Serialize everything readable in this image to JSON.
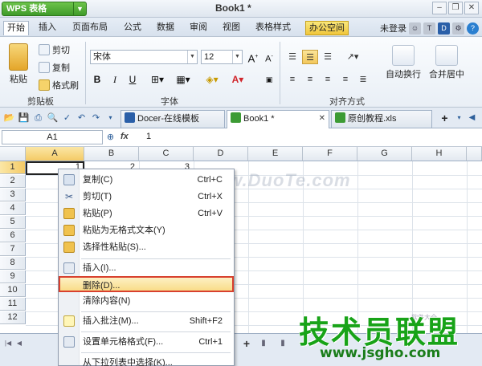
{
  "title_bar": {
    "app_name": "WPS 表格",
    "doc_title": "Book1 *"
  },
  "menu": {
    "tabs": [
      "开始",
      "插入",
      "页面布局",
      "公式",
      "数据",
      "审阅",
      "视图",
      "表格样式",
      "办公空间"
    ],
    "login": "未登录"
  },
  "ribbon": {
    "paste": "粘贴",
    "cut": "剪切",
    "copy": "复制",
    "format_painter": "格式刷",
    "clipboard_group": "剪贴板",
    "font_name": "宋体",
    "font_size": "12",
    "font_group": "字体",
    "bold": "B",
    "italic": "I",
    "underline": "U",
    "align_group": "对齐方式",
    "wrap_text": "自动换行",
    "merge_center": "合并居中"
  },
  "doc_tabs": [
    {
      "label": "Docer-在线模板",
      "icon": "docer-icon"
    },
    {
      "label": "Book1 *",
      "icon": "sheet-icon"
    },
    {
      "label": "原创教程.xls",
      "icon": "sheet-icon"
    }
  ],
  "formula_bar": {
    "cell_ref": "A1",
    "fx": "fx",
    "value": "1"
  },
  "grid": {
    "columns": [
      "A",
      "B",
      "C",
      "D",
      "E",
      "F",
      "G",
      "H"
    ],
    "rows": [
      "1",
      "2",
      "3",
      "4",
      "5",
      "6",
      "7",
      "8",
      "9",
      "10",
      "11",
      "12"
    ],
    "row1_values": [
      "1",
      "2",
      "3"
    ]
  },
  "context_menu": {
    "items": [
      {
        "label": "复制(C)",
        "shortcut": "Ctrl+C",
        "icon": "copy-icon"
      },
      {
        "label": "剪切(T)",
        "shortcut": "Ctrl+X",
        "icon": "cut-icon"
      },
      {
        "label": "粘贴(P)",
        "shortcut": "Ctrl+V",
        "icon": "paste-icon"
      },
      {
        "label": "粘贴为无格式文本(Y)",
        "shortcut": "",
        "icon": "paste-text-icon"
      },
      {
        "label": "选择性粘贴(S)...",
        "shortcut": "",
        "icon": "paste-special-icon"
      },
      {
        "label": "插入(I)...",
        "shortcut": "",
        "icon": "insert-icon"
      },
      {
        "label": "删除(D)...",
        "shortcut": "",
        "icon": ""
      },
      {
        "label": "清除内容(N)",
        "shortcut": "",
        "icon": ""
      },
      {
        "label": "插入批注(M)...",
        "shortcut": "Shift+F2",
        "icon": "comment-icon"
      },
      {
        "label": "设置单元格格式(F)...",
        "shortcut": "Ctrl+1",
        "icon": "format-cells-icon"
      },
      {
        "label": "从下拉列表中选择(K)...",
        "shortcut": "",
        "icon": ""
      }
    ]
  },
  "watermarks": {
    "site1": "www.DuoTe.com",
    "brand": "技术员联盟",
    "url": "www.jsgho.com"
  },
  "colors": {
    "accent_green": "#3f9b2a",
    "highlight_border": "#d8402e",
    "selection": "#f4ca66"
  }
}
